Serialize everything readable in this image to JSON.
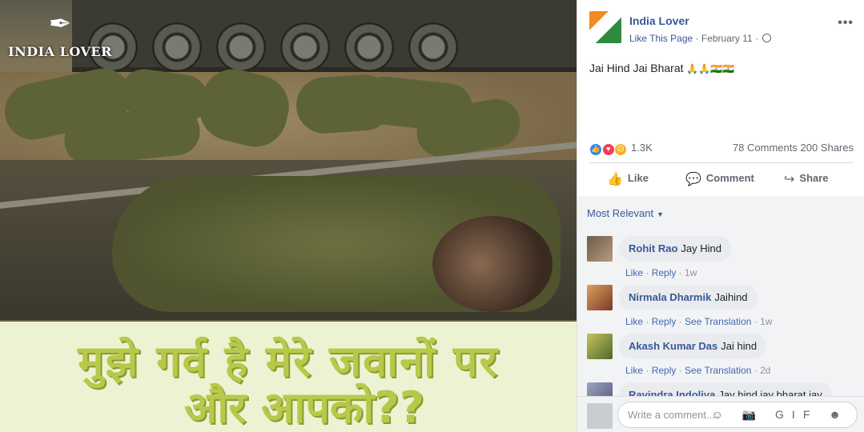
{
  "image": {
    "logo_text": "INDIA LOVER",
    "caption_line1": "मुझे गर्व है मेरे जवानों पर",
    "caption_line2": "और आपको??"
  },
  "post": {
    "page_name": "India Lover",
    "like_link": "Like This Page",
    "separator": "·",
    "date": "February 11",
    "separator2": "·",
    "more_label": "•••",
    "text": "Jai Hind Jai Bharat",
    "text_emoji": "🙏🙏🇮🇳🇮🇳",
    "reaction_count": "1.3K",
    "comments_count": "78 Comments",
    "shares_count": "200 Shares",
    "actions": {
      "like": "Like",
      "comment": "Comment",
      "share": "Share"
    }
  },
  "comments_section": {
    "sort_label": "Most Relevant",
    "comments": [
      {
        "author": "Rohit Rao",
        "text": "Jay Hind",
        "like": "Like",
        "reply": "Reply",
        "time": "1w",
        "translate": ""
      },
      {
        "author": "Nirmala Dharmik",
        "text": "Jaihind",
        "like": "Like",
        "reply": "Reply",
        "translate": "See Translation",
        "time": "1w"
      },
      {
        "author": "Akash Kumar Das",
        "text": "Jai hind",
        "like": "Like",
        "reply": "Reply",
        "translate": "See Translation",
        "time": "2d"
      },
      {
        "author": "Ravindra Indoliya",
        "text": "Jay hind jay bharat jay",
        "like": "",
        "reply": "",
        "translate": "",
        "time": ""
      }
    ],
    "composer_placeholder": "Write a comment...",
    "composer_icons": "☺ 📷 GIF ☻"
  },
  "colors": {
    "link_blue": "#385898",
    "caption_green": "#b8c84a",
    "like_blue": "#2d88ff",
    "love_red": "#f33e58",
    "sad_yellow": "#f7b125"
  }
}
